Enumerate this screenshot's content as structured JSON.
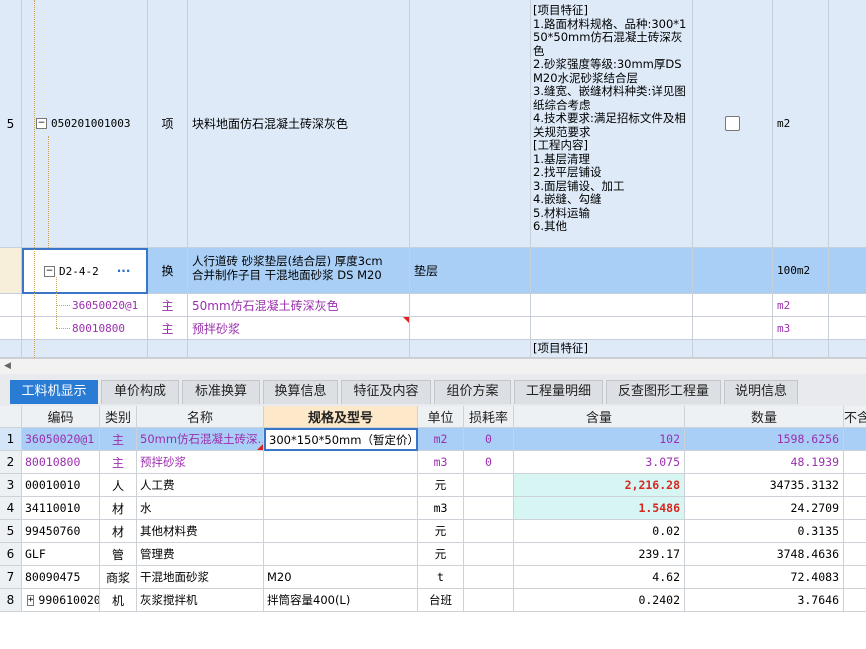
{
  "top_grid": {
    "row5": {
      "index": "5",
      "code": "050201001003",
      "type": "项",
      "name": "块料地面仿石混凝土砖深灰色",
      "features": [
        "[项目特征]",
        "1.路面材料规格、品种:300*150*50mm仿石混凝土砖深灰色",
        "2.砂浆强度等级:30mm厚DS M20水泥砂浆结合层",
        "3.缝宽、嵌缝材料种类:详见图纸综合考虑",
        "4.技术要求:满足招标文件及相关规范要求",
        "[工程内容]",
        "1.基层清理",
        "2.找平层铺设",
        "3.面层铺设、加工",
        "4.嵌缝、勾缝",
        "5.材料运输",
        "6.其他"
      ],
      "unit": "m2",
      "expander": "−"
    },
    "sel_row": {
      "code": "D2-4-2",
      "more": "···",
      "type": "换",
      "name_line1": "人行道砖 砂浆垫层(结合层) 厚度3cm",
      "name_line2": "合并制作子目 干混地面砂浆 DS M20",
      "spec": "垫层",
      "unit": "100m2",
      "expander": "−"
    },
    "sub_rows": [
      {
        "code": "36050020@1",
        "type": "主",
        "name": "50mm仿石混凝土砖深灰色",
        "unit": "m2"
      },
      {
        "code": "80010800",
        "type": "主",
        "name": "预拌砂浆",
        "unit": "m3"
      }
    ],
    "next_row": {
      "features": "[项目特征]"
    }
  },
  "tabs": [
    {
      "label": "工料机显示",
      "active": true
    },
    {
      "label": "单价构成",
      "active": false
    },
    {
      "label": "标准换算",
      "active": false
    },
    {
      "label": "换算信息",
      "active": false
    },
    {
      "label": "特征及内容",
      "active": false
    },
    {
      "label": "组价方案",
      "active": false
    },
    {
      "label": "工程量明细",
      "active": false
    },
    {
      "label": "反查图形工程量",
      "active": false
    },
    {
      "label": "说明信息",
      "active": false
    }
  ],
  "bottom_table": {
    "headers": {
      "code": "编码",
      "type": "类别",
      "name": "名称",
      "spec": "规格及型号",
      "unit": "单位",
      "loss": "损耗率",
      "content": "含量",
      "qty": "数量",
      "extra": "不含"
    },
    "rows": [
      {
        "num": "1",
        "code": "36050020@1",
        "type": "主",
        "name": "50mm仿石混凝土砖深…",
        "spec": "300*150*50mm（暂定价）",
        "unit": "m2",
        "loss": "0",
        "content": "102",
        "qty": "1598.6256"
      },
      {
        "num": "2",
        "code": "80010800",
        "type": "主",
        "name": "预拌砂浆",
        "spec": "",
        "unit": "m3",
        "loss": "0",
        "content": "3.075",
        "qty": "48.1939"
      },
      {
        "num": "3",
        "code": "00010010",
        "type": "人",
        "name": "人工费",
        "spec": "",
        "unit": "元",
        "loss": "",
        "content": "2,216.28",
        "qty": "34735.3132"
      },
      {
        "num": "4",
        "code": "34110010",
        "type": "材",
        "name": "水",
        "spec": "",
        "unit": "m3",
        "loss": "",
        "content": "1.5486",
        "qty": "24.2709"
      },
      {
        "num": "5",
        "code": "99450760",
        "type": "材",
        "name": "其他材料费",
        "spec": "",
        "unit": "元",
        "loss": "",
        "content": "0.02",
        "qty": "0.3135"
      },
      {
        "num": "6",
        "code": "GLF",
        "type": "管",
        "name": "管理费",
        "spec": "",
        "unit": "元",
        "loss": "",
        "content": "239.17",
        "qty": "3748.4636"
      },
      {
        "num": "7",
        "code": "80090475",
        "type": "商浆",
        "name": "干混地面砂浆",
        "spec": "M20",
        "unit": "t",
        "loss": "",
        "content": "4.62",
        "qty": "72.4083"
      },
      {
        "num": "8",
        "code": "990610020",
        "type": "机",
        "name": "灰浆搅拌机",
        "spec": "拌筒容量400(L)",
        "unit": "台班",
        "loss": "",
        "content": "0.2402",
        "qty": "3.7646",
        "expander": "+"
      }
    ]
  },
  "colors": {
    "accent": "#2a7bd3",
    "selected_row": "#a9cff6",
    "row_bg": "#deeaf8",
    "purple_text": "#9b2fae",
    "red_value": "#d6281f"
  }
}
